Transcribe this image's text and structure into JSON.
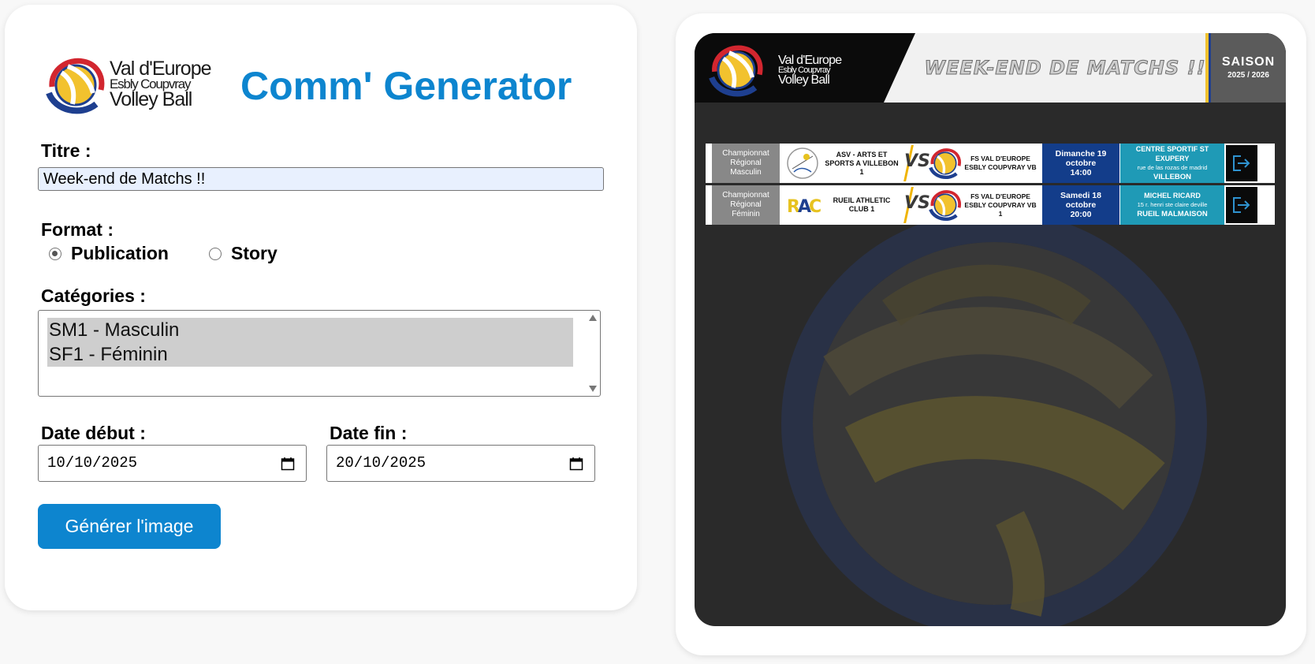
{
  "app": {
    "title": "Comm' Generator",
    "brand": {
      "line1": "Val d'Europe",
      "line2": "Esbly Coupvray",
      "line3": "Volley Ball"
    }
  },
  "form": {
    "titre_label": "Titre :",
    "titre_value": "Week-end de Matchs !!",
    "format_label": "Format :",
    "format_options": [
      {
        "label": "Publication",
        "checked": true
      },
      {
        "label": "Story",
        "checked": false
      }
    ],
    "categories_label": "Catégories :",
    "categories": [
      "SM1 - Masculin",
      "SF1 - Féminin"
    ],
    "date_debut_label": "Date début :",
    "date_debut_value": "10/10/2025",
    "date_fin_label": "Date fin :",
    "date_fin_value": "20/10/2025",
    "generate_label": "Générer l'image"
  },
  "preview": {
    "header_title": "WEEK-END DE MATCHS !!",
    "saison_label": "SAISON",
    "saison_years": "2025 / 2026",
    "vs_text": "VS",
    "matches": [
      {
        "champ_line1": "Championnat",
        "champ_line2": "Régional",
        "champ_line3": "Masculin",
        "home_team": "ASV - ARTS ET SPORTS A VILLEBON 1",
        "away_team": "FS VAL D'EUROPE ESBLY COUPVRAY VB",
        "date_line1": "Dimanche 19",
        "date_line2": "octobre",
        "date_line3": "14:00",
        "venue_name": "CENTRE SPORTIF ST EXUPERY",
        "venue_address": "rue de las rozas de madrid",
        "venue_city": "VILLEBON"
      },
      {
        "champ_line1": "Championnat",
        "champ_line2": "Régional",
        "champ_line3": "Féminin",
        "home_team": "RUEIL ATHLETIC CLUB 1",
        "away_team": "FS VAL D'EUROPE ESBLY COUPVRAY VB 1",
        "date_line1": "Samedi 18",
        "date_line2": "octobre",
        "date_line3": "20:00",
        "venue_name": "MICHEL RICARD",
        "venue_address": "15 r. henri ste claire deville",
        "venue_city": "RUEIL MALMAISON"
      }
    ]
  },
  "colors": {
    "accent": "#0d85cf",
    "date_block": "#133d8a",
    "venue_block": "#1f9ab6",
    "ball_yellow": "#f2c22e",
    "ball_blue": "#1e3f8f",
    "ball_red": "#d2262f"
  },
  "icons": [
    "calendar-icon",
    "exit-icon",
    "volleyball-logo-icon"
  ]
}
